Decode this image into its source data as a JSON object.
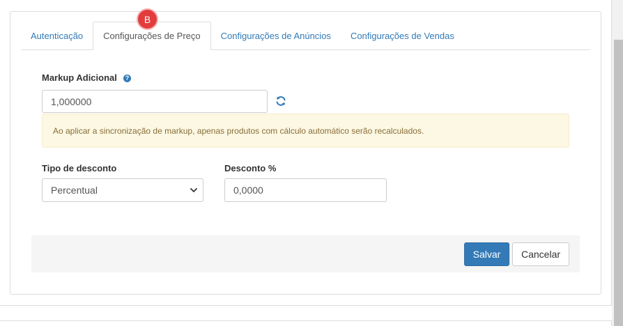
{
  "tabs": [
    {
      "label": "Autenticação",
      "active": false
    },
    {
      "label": "Configurações de Preço",
      "active": true
    },
    {
      "label": "Configurações de Anúncios",
      "active": false
    },
    {
      "label": "Configurações de Vendas",
      "active": false
    }
  ],
  "marker": {
    "label": "B"
  },
  "markup": {
    "label": "Markup Adicional",
    "help_icon": "?",
    "value": "1,000000"
  },
  "alert": {
    "text": "Ao aplicar a sincronização de markup, apenas produtos com cálculo automático serão recalculados."
  },
  "discount_type": {
    "label": "Tipo de desconto",
    "selected": "Percentual"
  },
  "discount_pct": {
    "label": "Desconto %",
    "value": "0,0000"
  },
  "buttons": {
    "save": "Salvar",
    "cancel": "Cancelar"
  },
  "colors": {
    "link": "#337ab7",
    "primary": "#337ab7",
    "alert_bg": "#fcf8e3",
    "alert_text": "#8a6d3b",
    "marker": "#e23c3c"
  }
}
